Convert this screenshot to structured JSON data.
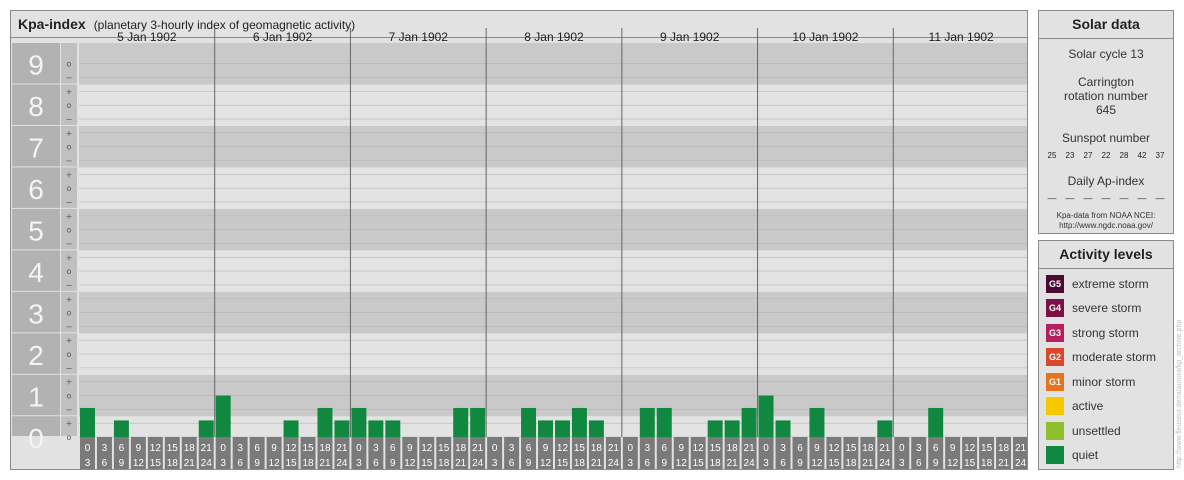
{
  "title": "Kpa-index",
  "subtitle": "(planetary 3-hourly index of geomagnetic activity)",
  "chart_data": {
    "type": "bar",
    "ylim": [
      0,
      9
    ],
    "y_ticks": [
      "0",
      "1",
      "2",
      "3",
      "4",
      "5",
      "6",
      "7",
      "8",
      "9"
    ],
    "minor_ticks": [
      "+",
      "o",
      "−"
    ],
    "days": [
      "5 Jan 1902",
      "6 Jan 1902",
      "7 Jan 1902",
      "8 Jan 1902",
      "9 Jan 1902",
      "10 Jan 1902",
      "11 Jan 1902"
    ],
    "interval_start": [
      "0",
      "3",
      "6",
      "9",
      "12",
      "15",
      "18",
      "21"
    ],
    "interval_end": [
      "3",
      "6",
      "9",
      "12",
      "15",
      "18",
      "21",
      "24"
    ],
    "values": [
      0.7,
      0,
      0.4,
      0,
      0,
      0,
      0,
      0.4,
      1.0,
      0,
      0,
      0,
      0.4,
      0,
      0.7,
      0.4,
      0.7,
      0.4,
      0.4,
      0,
      0,
      0,
      0.7,
      0.7,
      0,
      0,
      0.7,
      0.4,
      0.4,
      0.7,
      0.4,
      0,
      0,
      0.7,
      0.7,
      0,
      0,
      0.4,
      0.4,
      0.7,
      1.0,
      0.4,
      0,
      0.7,
      0,
      0,
      0,
      0.4,
      0,
      0,
      0.7,
      0,
      0,
      0,
      0,
      0
    ],
    "bar_color": "#118840"
  },
  "solar": {
    "title": "Solar data",
    "cycle": "Solar cycle 13",
    "carrington": "Carrington rotation number 645",
    "sunspot_title": "Sunspot number",
    "sunspot_values": [
      "25",
      "23",
      "27",
      "22",
      "28",
      "42",
      "37"
    ],
    "ap_title": "Daily Ap-index",
    "ap_values": [
      "––",
      "––",
      "––",
      "––",
      "––",
      "––",
      "––"
    ],
    "source_line1": "Kpa-data from NOAA NCEI:",
    "source_line2": "http://www.ngdc.noaa.gov/"
  },
  "activity": {
    "title": "Activity levels",
    "levels": [
      {
        "code": "G5",
        "label": "extreme storm",
        "color": "#4d0a30"
      },
      {
        "code": "G4",
        "label": "severe storm",
        "color": "#7a1245"
      },
      {
        "code": "G3",
        "label": "strong storm",
        "color": "#b51f60"
      },
      {
        "code": "G2",
        "label": "moderate storm",
        "color": "#d9482d"
      },
      {
        "code": "G1",
        "label": "minor storm",
        "color": "#e4751e"
      },
      {
        "code": "",
        "label": "active",
        "color": "#f5c800"
      },
      {
        "code": "",
        "label": "unsettled",
        "color": "#8cbf2b"
      },
      {
        "code": "",
        "label": "quiet",
        "color": "#118840"
      }
    ]
  },
  "watermark": "http://www.fleuseur.de/ra/aurora/kp_archive.php"
}
